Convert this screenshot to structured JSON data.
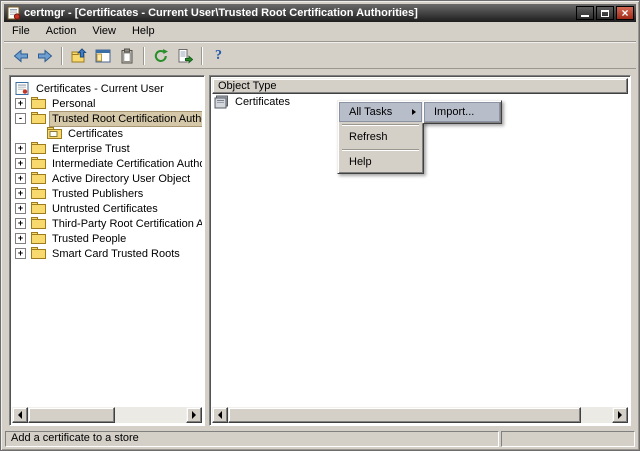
{
  "colors": {
    "titlebar_top": "#6b6b6b",
    "titlebar_bottom": "#1d1d1d",
    "close_button": "#a02a17",
    "window_bg": "#d4d0c8",
    "pane_bg": "#ffffff",
    "tree_selection_bg": "#d5c8a8",
    "menu_highlight_bg": "#b7bdc9",
    "folder_icon": "#f7d96d"
  },
  "window": {
    "title": "certmgr - [Certificates - Current User\\Trusted Root Certification Authorities]",
    "icon": "certmgr-certificate-icon",
    "controls": [
      "minimize-icon",
      "maximize-icon",
      "close-icon"
    ]
  },
  "menubar": {
    "items": [
      {
        "label": "File"
      },
      {
        "label": "Action"
      },
      {
        "label": "View"
      },
      {
        "label": "Help"
      }
    ]
  },
  "toolbar": {
    "icons": [
      "back-icon",
      "forward-icon",
      "up-level-icon",
      "show-hide-tree-icon",
      "copy-icon",
      "refresh-icon",
      "export-list-icon",
      "help-icon"
    ]
  },
  "tree": {
    "items": [
      {
        "label": "Certificates - Current User",
        "expander": "",
        "icon": "certificates-root-icon",
        "selected": false
      },
      {
        "label": "Personal",
        "expander": "+",
        "icon": "folder-icon",
        "selected": false
      },
      {
        "label": "Trusted Root Certification Autho",
        "expander": "-",
        "icon": "folder-icon",
        "selected": true
      },
      {
        "label": "Certificates",
        "expander": "",
        "icon": "certificates-folder-icon",
        "selected": false
      },
      {
        "label": "Enterprise Trust",
        "expander": "+",
        "icon": "folder-icon",
        "selected": false
      },
      {
        "label": "Intermediate Certification Autho",
        "expander": "+",
        "icon": "folder-icon",
        "selected": false
      },
      {
        "label": "Active Directory User Object",
        "expander": "+",
        "icon": "folder-icon",
        "selected": false
      },
      {
        "label": "Trusted Publishers",
        "expander": "+",
        "icon": "folder-icon",
        "selected": false
      },
      {
        "label": "Untrusted Certificates",
        "expander": "+",
        "icon": "folder-icon",
        "selected": false
      },
      {
        "label": "Third-Party Root Certification Au",
        "expander": "+",
        "icon": "folder-icon",
        "selected": false
      },
      {
        "label": "Trusted People",
        "expander": "+",
        "icon": "folder-icon",
        "selected": false
      },
      {
        "label": "Smart Card Trusted Roots",
        "expander": "+",
        "icon": "folder-icon",
        "selected": false
      }
    ]
  },
  "list": {
    "header": "Object Type",
    "items": [
      {
        "label": "Certificates",
        "icon": "certificates-stack-icon"
      }
    ]
  },
  "context_menu": {
    "items": [
      {
        "label": "All Tasks",
        "has_submenu": true,
        "highlighted": true
      },
      {
        "label": "Refresh",
        "has_submenu": false,
        "highlighted": false
      },
      {
        "label": "Help",
        "has_submenu": false,
        "highlighted": false
      }
    ],
    "submenu": {
      "items": [
        {
          "label": "Import...",
          "highlighted": true
        }
      ]
    }
  },
  "statusbar": {
    "text": "Add a certificate to a store"
  }
}
